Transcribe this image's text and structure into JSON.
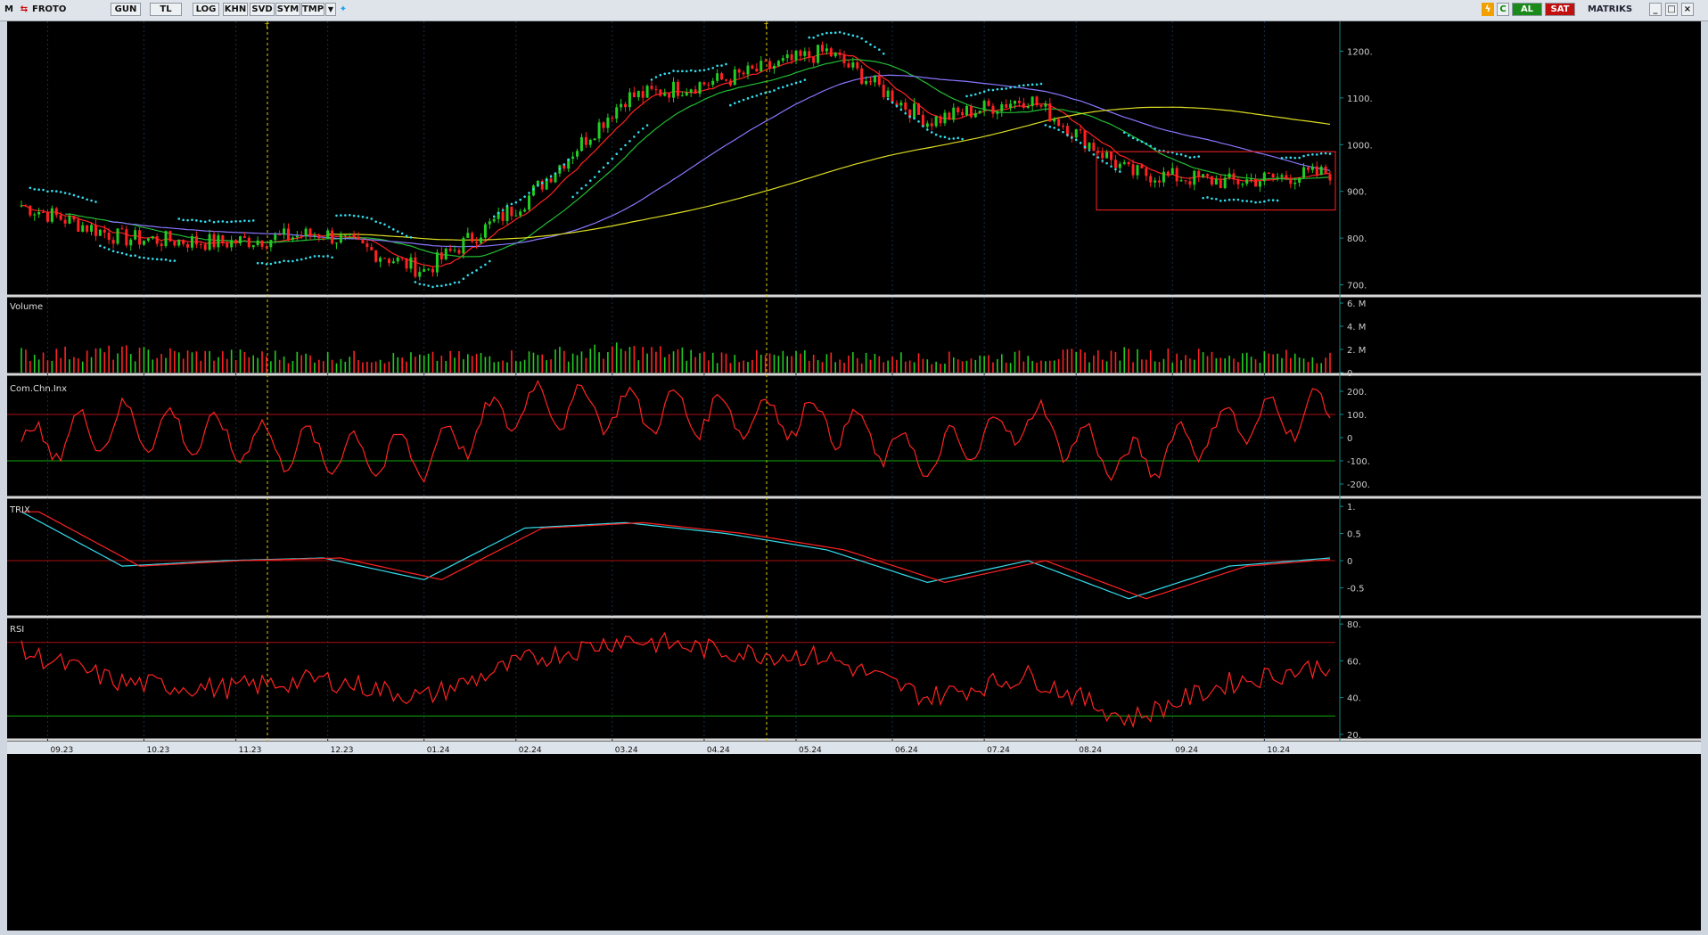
{
  "toolbar": {
    "m_label": "M",
    "symbol": "FROTO",
    "period": "GUN",
    "currency": "TL",
    "buttons": [
      "LOG",
      "KHN",
      "SVD",
      "SYM",
      "TMP"
    ],
    "al_label": "AL",
    "sat_label": "SAT",
    "brand": "MATRIKS",
    "c_label": "C"
  },
  "panels": {
    "price": {
      "ticks": [
        "1200.",
        "1100.",
        "1000.",
        "900.",
        "800.",
        "700."
      ]
    },
    "volume": {
      "label": "Volume",
      "ticks": [
        "6. M",
        "4. M",
        "2. M",
        "0"
      ]
    },
    "cci": {
      "label": "Com.Chn.Inx",
      "ticks": [
        "200.",
        "100.",
        "0",
        "-100.",
        "-200."
      ]
    },
    "trix": {
      "label": "TRIX",
      "ticks": [
        "1.",
        "0.5",
        "0",
        "-0.5"
      ]
    },
    "rsi": {
      "label": "RSI",
      "ticks": [
        "80.",
        "60.",
        "40.",
        "20."
      ]
    }
  },
  "markers": [
    "T",
    "T"
  ],
  "dates": [
    "09.23",
    "10.23",
    "11.23",
    "12.23",
    "01.24",
    "02.24",
    "03.24",
    "04.24",
    "05.24",
    "06.24",
    "07.24",
    "08.24",
    "09.24",
    "10.24"
  ],
  "colors": {
    "up": "#22cc22",
    "down": "#ff2222",
    "sar": "#33ddee",
    "ma_short": "#ff2222",
    "ma_mid": "#22bb33",
    "ma_long": "#8877ff",
    "ma_200": "#dddd22",
    "trix": "#33ddee",
    "trix_signal": "#ff2222",
    "marker": "#ddcc00"
  },
  "chart_data": {
    "type": "candlestick",
    "x": [
      "09.23",
      "10.23",
      "11.23",
      "12.23",
      "01.24",
      "02.24",
      "03.24",
      "04.24",
      "05.24",
      "06.24",
      "07.24",
      "08.24",
      "09.24",
      "10.24"
    ],
    "close": [
      870,
      800,
      790,
      810,
      730,
      880,
      1100,
      1140,
      1200,
      1050,
      1100,
      940,
      920,
      940
    ],
    "volume_millions": [
      1.5,
      1.6,
      1.4,
      1.3,
      1.2,
      1.4,
      1.8,
      1.3,
      1.3,
      1.2,
      1.3,
      1.5,
      1.4,
      1.3
    ],
    "cci": [
      -40,
      60,
      0,
      -60,
      -80,
      150,
      120,
      100,
      80,
      -100,
      80,
      -120,
      60,
      120
    ],
    "trix": [
      0.9,
      -0.1,
      0.0,
      0.05,
      -0.35,
      0.6,
      0.7,
      0.5,
      0.2,
      -0.4,
      0.0,
      -0.7,
      -0.1,
      0.05
    ],
    "rsi": [
      65,
      48,
      45,
      50,
      40,
      60,
      72,
      65,
      62,
      40,
      52,
      28,
      48,
      58
    ],
    "ylim_price": [
      680,
      1260
    ],
    "ylim_volume": [
      0,
      6
    ],
    "ylim_cci": [
      -250,
      250
    ],
    "ylim_trix": [
      -1,
      1.1
    ],
    "ylim_rsi": [
      18,
      82
    ]
  }
}
